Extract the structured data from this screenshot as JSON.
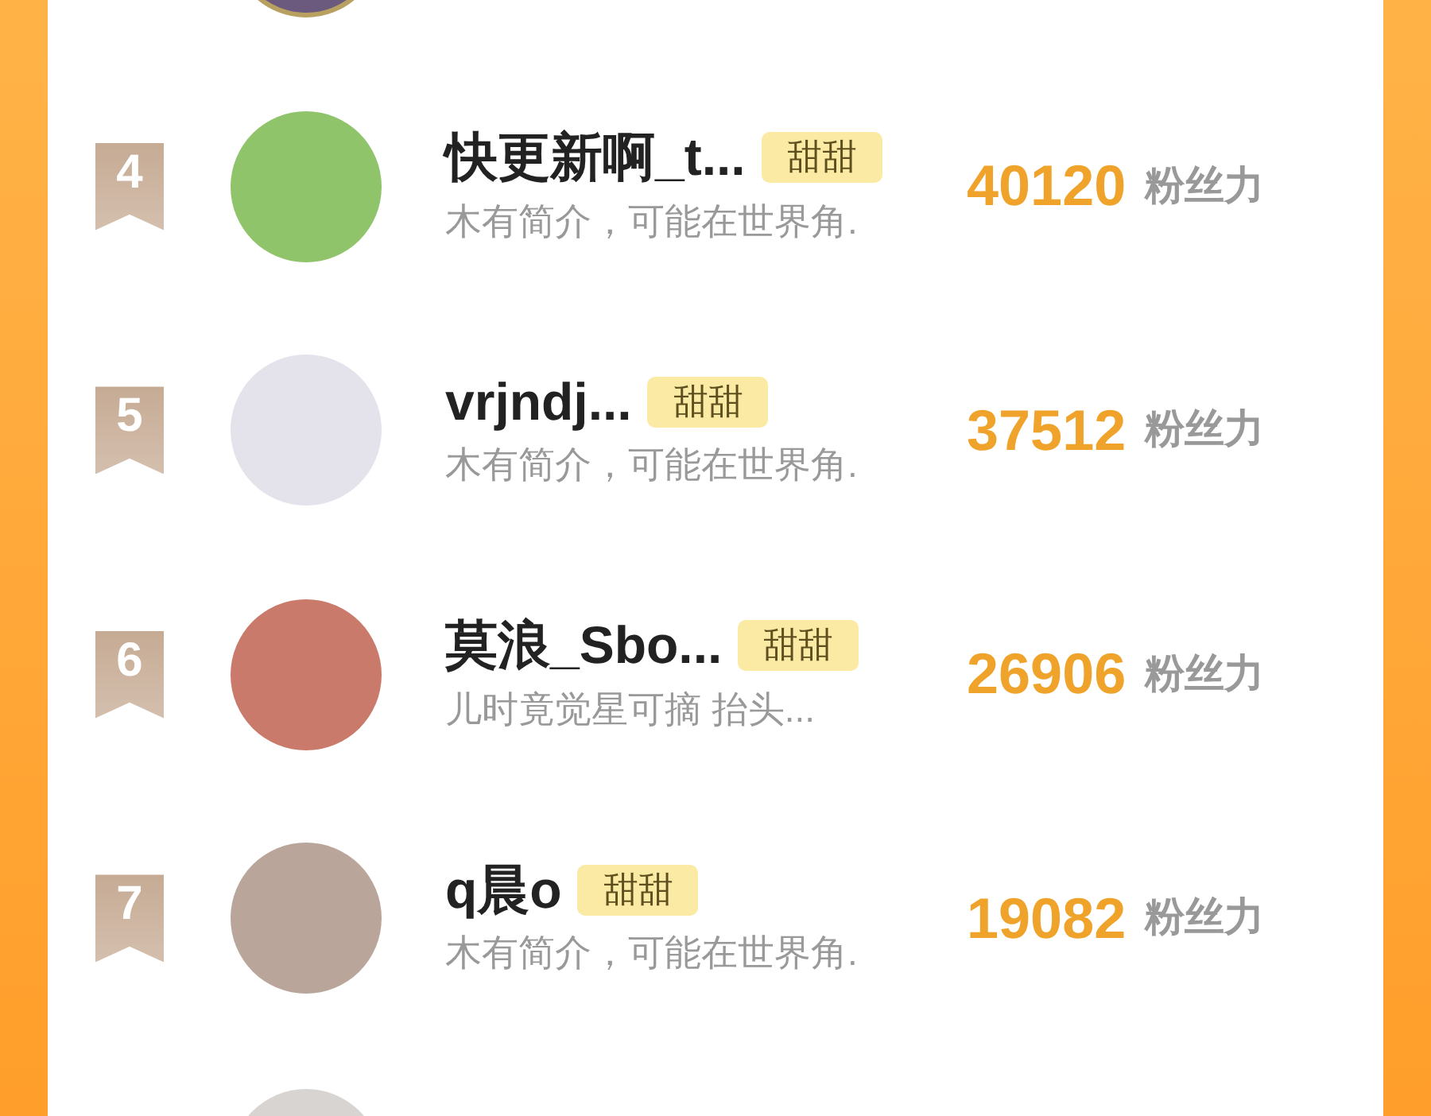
{
  "ranking": [
    {
      "rank": "4",
      "name": "快更新啊_t...",
      "tag": "甜甜",
      "bio": "木有简介，可能在世界角.",
      "score": "40120",
      "unit": "粉丝力"
    },
    {
      "rank": "5",
      "name": "vrjndj...",
      "tag": "甜甜",
      "bio": "木有简介，可能在世界角.",
      "score": "37512",
      "unit": "粉丝力"
    },
    {
      "rank": "6",
      "name": "莫浪_Sbo...",
      "tag": "甜甜",
      "bio": "儿时竟觉星可摘 抬头...",
      "score": "26906",
      "unit": "粉丝力"
    },
    {
      "rank": "7",
      "name": "q晨o",
      "tag": "甜甜",
      "bio": "木有简介，可能在世界角.",
      "score": "19082",
      "unit": "粉丝力"
    }
  ]
}
